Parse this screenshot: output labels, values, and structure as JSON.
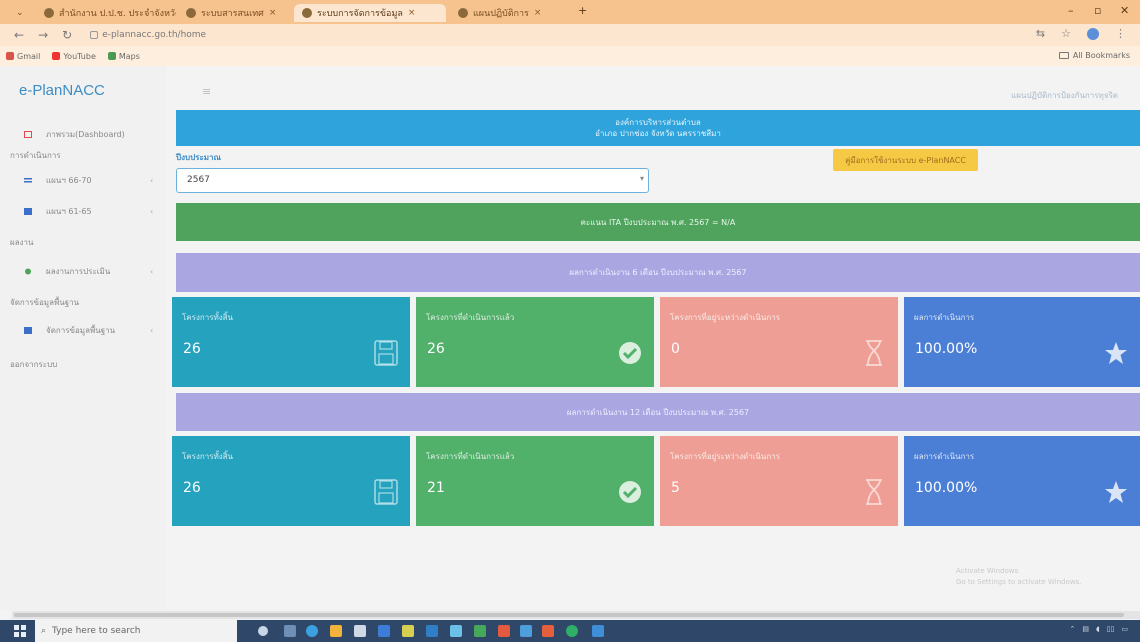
{
  "browser": {
    "tabs": [
      {
        "label": "สำนักงาน ป.ป.ช. ประจำจังหวัด"
      },
      {
        "label": "ระบบสารสนเทศ"
      },
      {
        "label": "ระบบการจัดการข้อมูล"
      },
      {
        "label": "แผนปฏิบัติการ"
      }
    ],
    "url": "e-plannacc.go.th/home",
    "bookmarks": [
      "Gmail",
      "YouTube",
      "Maps"
    ],
    "all_bookmarks": "All Bookmarks"
  },
  "sidebar": {
    "brand": "e-PlanNACC",
    "dashboard": "ภาพรวม(Dashboard)",
    "section_plans": "การดำเนินการ",
    "plan_66_70": "แผนฯ 66-70",
    "plan_61_65": "แผนฯ 61-65",
    "section_eval": "ผลงาน",
    "eval_item": "ผลงานการประเมิน",
    "section_data": "จัดการข้อมูลพื้นฐาน",
    "data_item": "จัดการข้อมูลพื้นฐาน",
    "logout": "ออกจากระบบ"
  },
  "header": {
    "breadcrumb": "แผนปฏิบัติการป้องกันการทุจริต"
  },
  "banner": {
    "line1": "องค์การบริหารส่วนตำบล",
    "line2": "อำเภอ ปากช่อง จังหวัด นครราชสีมา"
  },
  "filters": {
    "year_label": "ปีงบประมาณ",
    "year_value": "2567",
    "manual_button": "คู่มือการใช้งานระบบ e-PlanNACC"
  },
  "ita_bar": "คะแนน ITA ปีงบประมาณ พ.ศ. 2567 = N/A",
  "six_month": {
    "title": "ผลการดำเนินงาน 6 เดือน ปีงบประมาณ พ.ศ. 2567",
    "cards": [
      {
        "label": "โครงการทั้งสิ้น",
        "value": "26"
      },
      {
        "label": "โครงการที่ดำเนินการแล้ว",
        "value": "26"
      },
      {
        "label": "โครงการที่อยู่ระหว่างดำเนินการ",
        "value": "0"
      },
      {
        "label": "ผลการดำเนินการ",
        "value": "100.00%"
      }
    ]
  },
  "twelve_month": {
    "title": "ผลการดำเนินงาน 12 เดือน ปีงบประมาณ พ.ศ. 2567",
    "cards": [
      {
        "label": "โครงการทั้งสิ้น",
        "value": "26"
      },
      {
        "label": "โครงการที่ดำเนินการแล้ว",
        "value": "21"
      },
      {
        "label": "โครงการที่อยู่ระหว่างดำเนินการ",
        "value": "5"
      },
      {
        "label": "ผลการดำเนินการ",
        "value": "100.00%"
      }
    ]
  },
  "watermark": {
    "line1": "Activate Windows",
    "line2": "Go to Settings to activate Windows."
  },
  "taskbar": {
    "search_placeholder": "Type here to search"
  },
  "colors": {
    "banner": "#2ea3dc",
    "ita": "#4fa35c",
    "period": "#aaa6e2",
    "blue": "#25a2be",
    "green": "#51b06a",
    "red": "#ee9e94",
    "navy": "#4b7fd5",
    "manual": "#f6c944"
  }
}
